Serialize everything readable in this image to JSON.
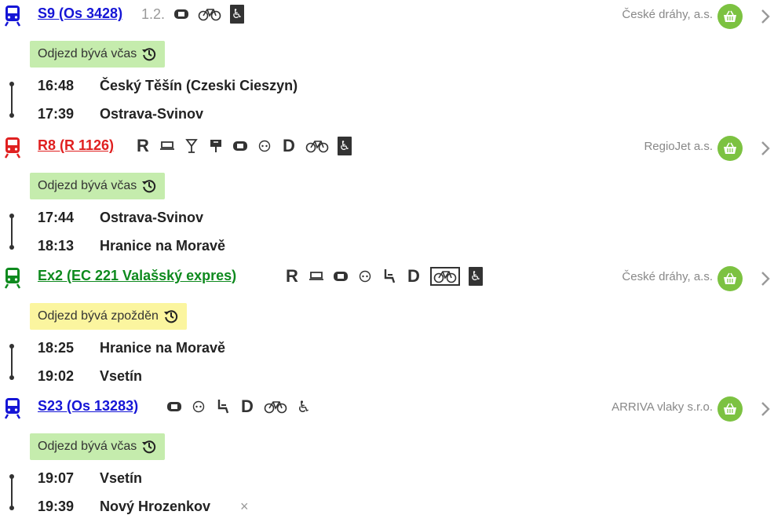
{
  "legs": [
    {
      "color": "#1515d6",
      "link": "S9 (Os 3428)",
      "position": "1.2.",
      "services": [
        "ticket-icon",
        "bike-icon",
        "wheelchair-box-icon"
      ],
      "carrier": "České dráhy, a.s.",
      "badge": {
        "text": "Odjezd bývá včas",
        "type": "ok"
      },
      "stops": [
        {
          "time": "16:48",
          "name": "Český Těšín (Czeski Cieszyn)"
        },
        {
          "time": "17:39",
          "name": "Ostrava-Svinov"
        }
      ]
    },
    {
      "color": "#e02020",
      "link": "R8 (R 1126)",
      "services": [
        "R",
        "sleeper-icon",
        "bar-icon",
        "restaurant-icon",
        "ticket-icon",
        "power-icon",
        "D",
        "bike-icon",
        "wheelchair-box-icon"
      ],
      "carrier": "RegioJet a.s.",
      "badge": {
        "text": "Odjezd bývá včas",
        "type": "ok"
      },
      "stops": [
        {
          "time": "17:44",
          "name": "Ostrava-Svinov"
        },
        {
          "time": "18:13",
          "name": "Hranice na Moravě"
        }
      ]
    },
    {
      "color": "#0e8a1e",
      "link": "Ex2 (EC 221 Valašský expres)",
      "services": [
        "R",
        "sleeper-icon",
        "ticket-icon",
        "power-icon",
        "seat-icon",
        "D",
        "bike-box-icon",
        "wheelchair-box-icon"
      ],
      "carrier": "České dráhy, a.s.",
      "badge": {
        "text": "Odjezd bývá zpožděn",
        "type": "late"
      },
      "stops": [
        {
          "time": "18:25",
          "name": "Hranice na Moravě"
        },
        {
          "time": "19:02",
          "name": "Vsetín"
        }
      ]
    },
    {
      "color": "#1515d6",
      "link": "S23 (Os 13283)",
      "services": [
        "ticket-icon",
        "power-icon",
        "seat-icon",
        "D",
        "bike-icon",
        "wheelchair-icon"
      ],
      "carrier": "ARRIVA vlaky s.r.o.",
      "badge": {
        "text": "Odjezd bývá včas",
        "type": "ok"
      },
      "stops": [
        {
          "time": "19:07",
          "name": "Vsetín"
        },
        {
          "time": "19:39",
          "name": "Nový Hrozenkov",
          "cross": "×"
        }
      ]
    }
  ],
  "colors": {
    "basket": "#7cc241",
    "badge_ok": "#c5ecad",
    "badge_late": "#fbf59f",
    "route": "#333333"
  }
}
